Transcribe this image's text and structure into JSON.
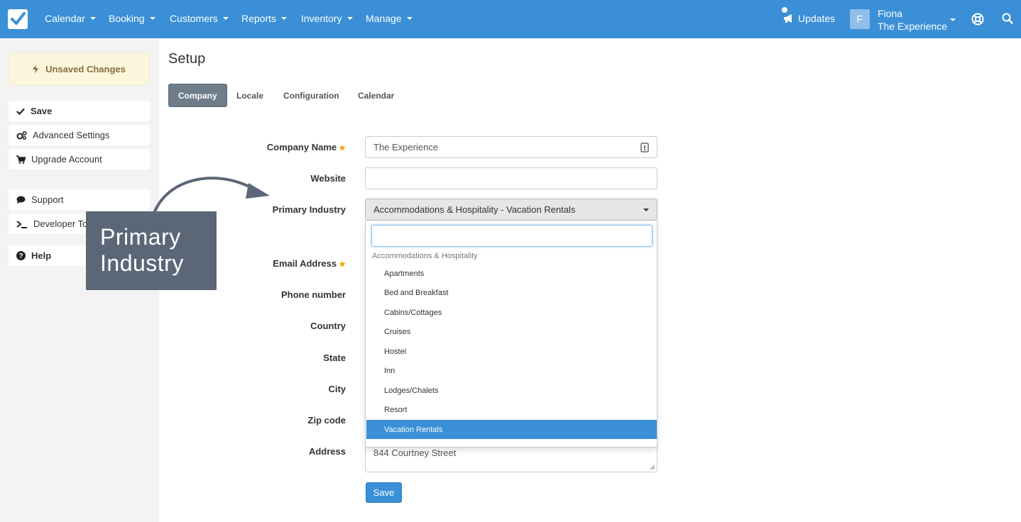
{
  "nav": {
    "items": [
      {
        "label": "Calendar"
      },
      {
        "label": "Booking"
      },
      {
        "label": "Customers"
      },
      {
        "label": "Reports"
      },
      {
        "label": "Inventory"
      },
      {
        "label": "Manage"
      }
    ],
    "updates_label": "Updates",
    "user": {
      "initial": "F",
      "name": "Fiona",
      "company": "The Experience"
    }
  },
  "sidebar": {
    "unsaved_label": "Unsaved Changes",
    "buttons": [
      {
        "label": "Save",
        "icon": "check-icon"
      },
      {
        "label": "Advanced Settings",
        "icon": "cogs-icon"
      },
      {
        "label": "Upgrade Account",
        "icon": "cart-icon"
      },
      {
        "label": "Support",
        "icon": "comment-icon"
      },
      {
        "label": "Developer Tools",
        "icon": "terminal-icon"
      },
      {
        "label": "Help",
        "icon": "question-circle-icon"
      }
    ]
  },
  "page": {
    "title": "Setup",
    "tabs": [
      {
        "label": "Company",
        "active": true
      },
      {
        "label": "Locale",
        "active": false
      },
      {
        "label": "Configuration",
        "active": false
      },
      {
        "label": "Calendar",
        "active": false
      }
    ]
  },
  "form": {
    "company_name": {
      "label": "Company Name",
      "value": "The Experience",
      "required": true
    },
    "website": {
      "label": "Website",
      "value": ""
    },
    "primary_industry": {
      "label": "Primary Industry",
      "value": "Accommodations & Hospitality - Vacation Rentals"
    },
    "email": {
      "label": "Email Address",
      "required": true
    },
    "phone": {
      "label": "Phone number"
    },
    "country": {
      "label": "Country"
    },
    "state": {
      "label": "State"
    },
    "city": {
      "label": "City"
    },
    "zip": {
      "label": "Zip code"
    },
    "address": {
      "label": "Address",
      "value": "844 Courtney Street"
    },
    "save_label": "Save"
  },
  "dropdown": {
    "search_value": "",
    "group_label": "Accommodations & Hospitality",
    "options": [
      "Apartments",
      "Bed and Breakfast",
      "Cabins/Cottages",
      "Cruises",
      "Hostel",
      "Inn",
      "Lodges/Chalets",
      "Resort",
      "Vacation Rentals"
    ],
    "selected": "Vacation Rentals"
  },
  "callout": {
    "line1": "Primary",
    "line2": "Industry"
  },
  "colors": {
    "primary": "#3a8fd6",
    "callout": "#5b6777",
    "warning_bg": "#fbf6dc"
  }
}
